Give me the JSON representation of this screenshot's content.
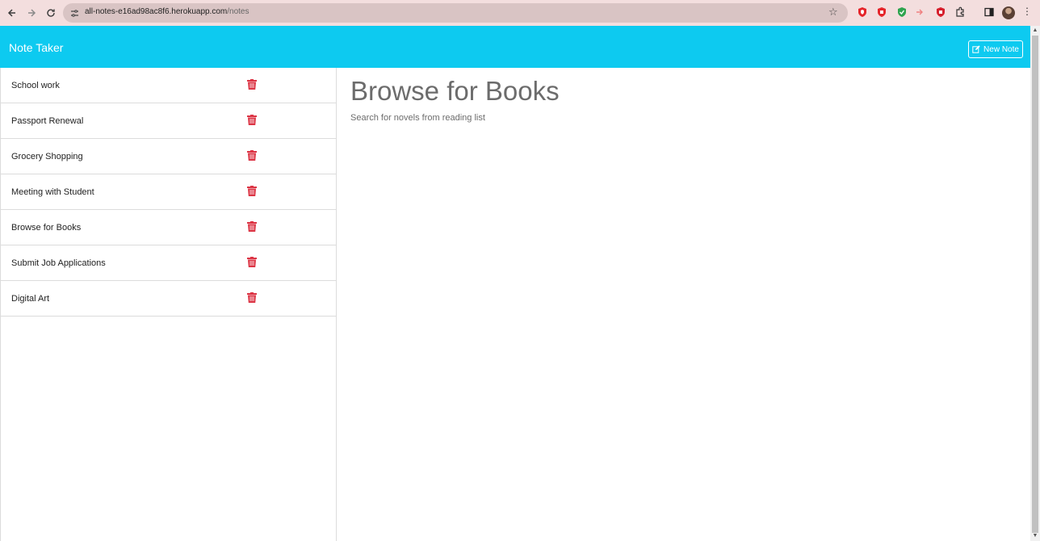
{
  "browser": {
    "url_host": "all-notes-e16ad98ac8f6.herokuapp.com",
    "url_path": "/notes"
  },
  "app": {
    "title": "Note Taker",
    "new_note_label": "New Note",
    "accent": "#0dcaf0",
    "delete_color": "#dc3545"
  },
  "notes": [
    {
      "label": "School work"
    },
    {
      "label": "Passport Renewal"
    },
    {
      "label": "Grocery Shopping"
    },
    {
      "label": "Meeting with Student"
    },
    {
      "label": "Browse for Books"
    },
    {
      "label": "Submit Job Applications"
    },
    {
      "label": "Digital Art"
    }
  ],
  "active_note": {
    "title": "Browse for Books",
    "text": "Search for novels from reading list"
  }
}
